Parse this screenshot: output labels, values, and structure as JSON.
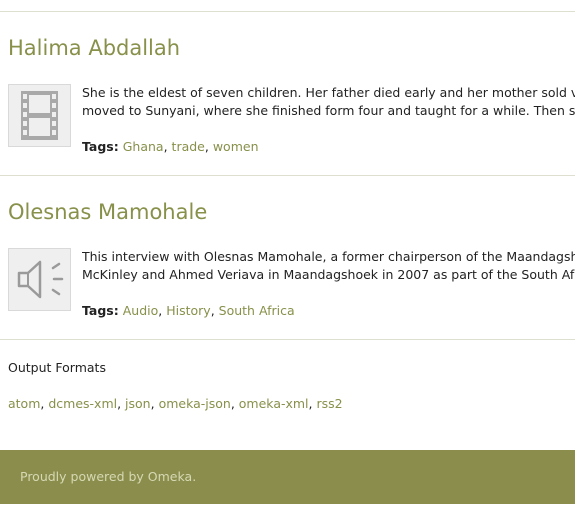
{
  "items": [
    {
      "title": "Halima Abdallah",
      "thumb_icon": "film-icon",
      "desc_line1": "She is the eldest of seven children. Her father died early and her mother sold v",
      "desc_line2": "moved to Sunyani, where she finished form four and taught for a while. Then s",
      "tags_label": "Tags:",
      "tags": [
        "Ghana",
        "trade",
        "women"
      ]
    },
    {
      "title": "Olesnas Mamohale",
      "thumb_icon": "audio-speaker-icon",
      "desc_line1": "This interview with Olesnas Mamohale, a former chairperson of the Maandagsh",
      "desc_line2": "McKinley and Ahmed Veriava in Maandagshoek in 2007 as part of the South Afr",
      "tags_label": "Tags:",
      "tags": [
        "Audio",
        "History",
        "South Africa"
      ]
    }
  ],
  "output_formats": {
    "heading": "Output Formats",
    "formats": [
      "atom",
      "dcmes-xml",
      "json",
      "omeka-json",
      "omeka-xml",
      "rss2"
    ]
  },
  "footer": {
    "text_prefix": "Proudly powered by ",
    "link": "Omeka",
    "text_suffix": "."
  },
  "colors": {
    "accent": "#88904a",
    "footer_bg": "#8a8d4b",
    "rule": "#dedfcf"
  }
}
